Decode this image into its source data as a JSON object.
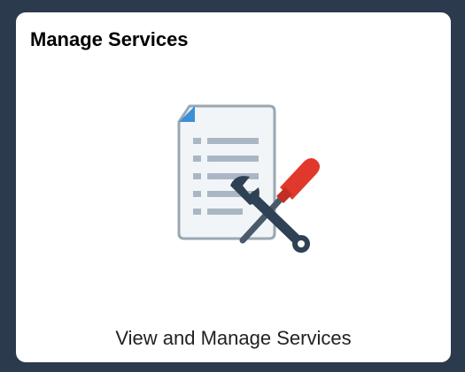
{
  "tile": {
    "title": "Manage Services",
    "subtitle": "View and Manage Services",
    "icon": "document-tools-icon"
  },
  "colors": {
    "background": "#2b3a4d",
    "tile": "#ffffff",
    "doc_fill": "#f2f5f8",
    "doc_border": "#9aa7b2",
    "doc_fold": "#3d8fd6",
    "doc_lines": "#a9b7c4",
    "wrench": "#2f4154",
    "screwdriver_handle": "#e0392b",
    "screwdriver_shaft": "#4a5a6a"
  }
}
